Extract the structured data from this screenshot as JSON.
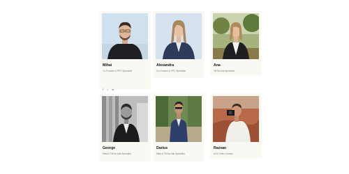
{
  "team": {
    "members": [
      {
        "name": "Mihai",
        "role": "Co-Founder & PPC Specialist",
        "social": [
          "facebook",
          "twitter",
          "linkedin"
        ]
      },
      {
        "name": "Alexandra",
        "role": "Co-Founder & PPC Specialist"
      },
      {
        "name": "Ana",
        "role": "TikTok Ads Specialist"
      },
      {
        "name": "George",
        "role": "Meta & TikTok Ads Specialist"
      },
      {
        "name": "Darius",
        "role": "Meta & TikTok Ads Specialist"
      },
      {
        "name": "Razvan",
        "role": "UGC Video Creator"
      }
    ],
    "social_icons": {
      "facebook": "f",
      "twitter": "✓",
      "linkedin": "in"
    }
  },
  "colors": {
    "card_bg": "#faf8f2",
    "name": "#111111",
    "role": "#777777"
  }
}
